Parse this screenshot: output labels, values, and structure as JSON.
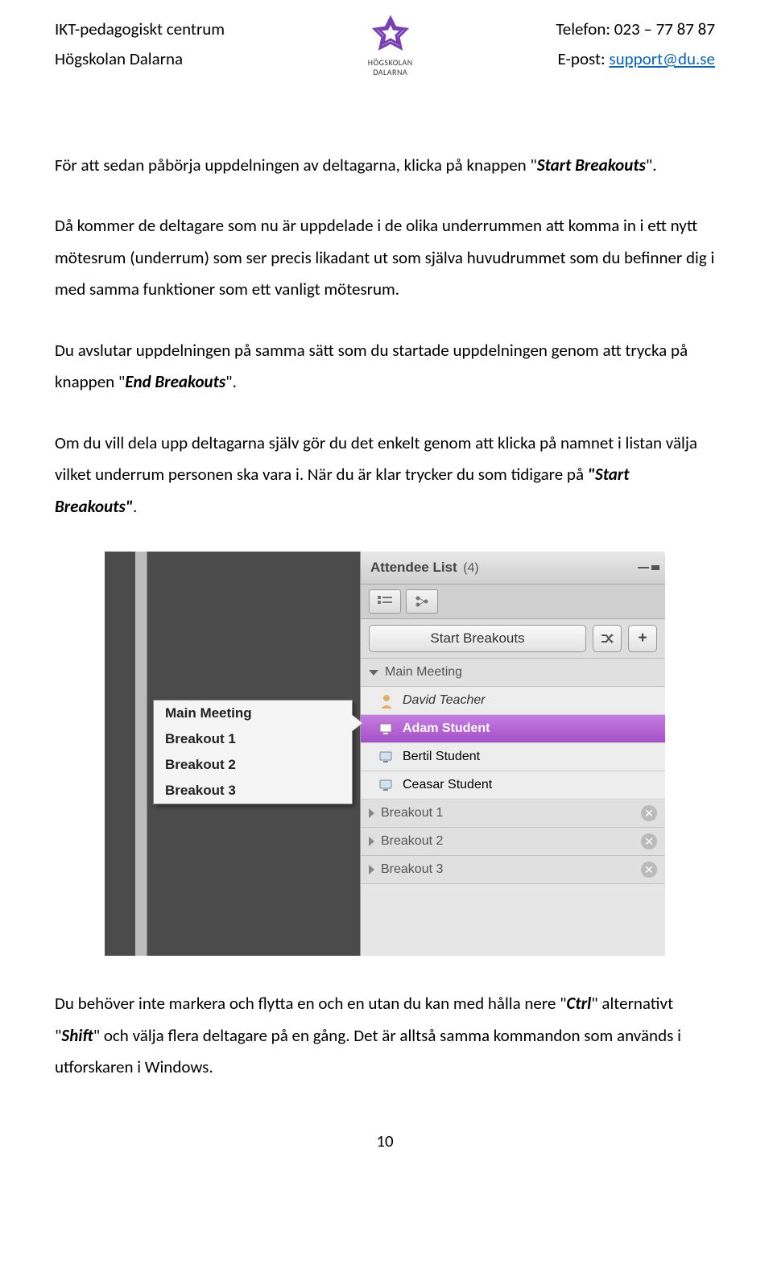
{
  "header": {
    "left1": "IKT-pedagogiskt centrum",
    "left2": "Högskolan Dalarna",
    "right1": "Telefon: 023 – 77 87 87",
    "right2_prefix": "E-post: ",
    "right2_link": "support@du.se",
    "logo_text1": "HÖGSKOLAN",
    "logo_text2": "DALARNA"
  },
  "para1_a": "För att sedan påbörja uppdelningen av deltagarna, klicka på knappen \"",
  "para1_b": "Start Breakouts",
  "para1_c": "\".",
  "para2": "Då kommer de deltagare som nu är uppdelade i de olika underrummen att komma in i ett nytt mötesrum (underrum) som ser precis likadant ut som själva huvudrummet som du befinner dig i med samma funktioner som ett vanligt mötesrum.",
  "para3_a": "Du avslutar uppdelningen på samma sätt som du startade uppdelningen genom att trycka på knappen \"",
  "para3_b": "End Breakouts",
  "para3_c": "\".",
  "para4_a": "Om du vill dela upp deltagarna själv gör du det enkelt genom att klicka på namnet i listan välja vilket underrum personen ska vara i. När du är klar trycker du som tidigare på ",
  "para4_b": "\"Start Breakouts\"",
  "para4_c": ".",
  "screenshot": {
    "panel_title": "Attendee List",
    "panel_count": "(4)",
    "start_button": "Start Breakouts",
    "plus": "+",
    "section_main": "Main Meeting",
    "attendees": [
      {
        "name": "David Teacher",
        "type": "host"
      },
      {
        "name": "Adam Student",
        "type": "selected"
      },
      {
        "name": "Bertil Student",
        "type": "participant"
      },
      {
        "name": "Ceasar Student",
        "type": "participant"
      }
    ],
    "breakouts": [
      "Breakout 1",
      "Breakout 2",
      "Breakout 3"
    ],
    "tooltip": [
      "Main Meeting",
      "Breakout 1",
      "Breakout 2",
      "Breakout 3"
    ]
  },
  "para5_a": "Du behöver inte markera och flytta en och en utan du kan med hålla nere \"",
  "para5_b": "Ctrl",
  "para5_c": "\" alternativt \"",
  "para5_d": "Shift",
  "para5_e": "\" och välja flera deltagare på en gång. Det är alltså samma kommandon som används i utforskaren i Windows.",
  "page_number": "10"
}
